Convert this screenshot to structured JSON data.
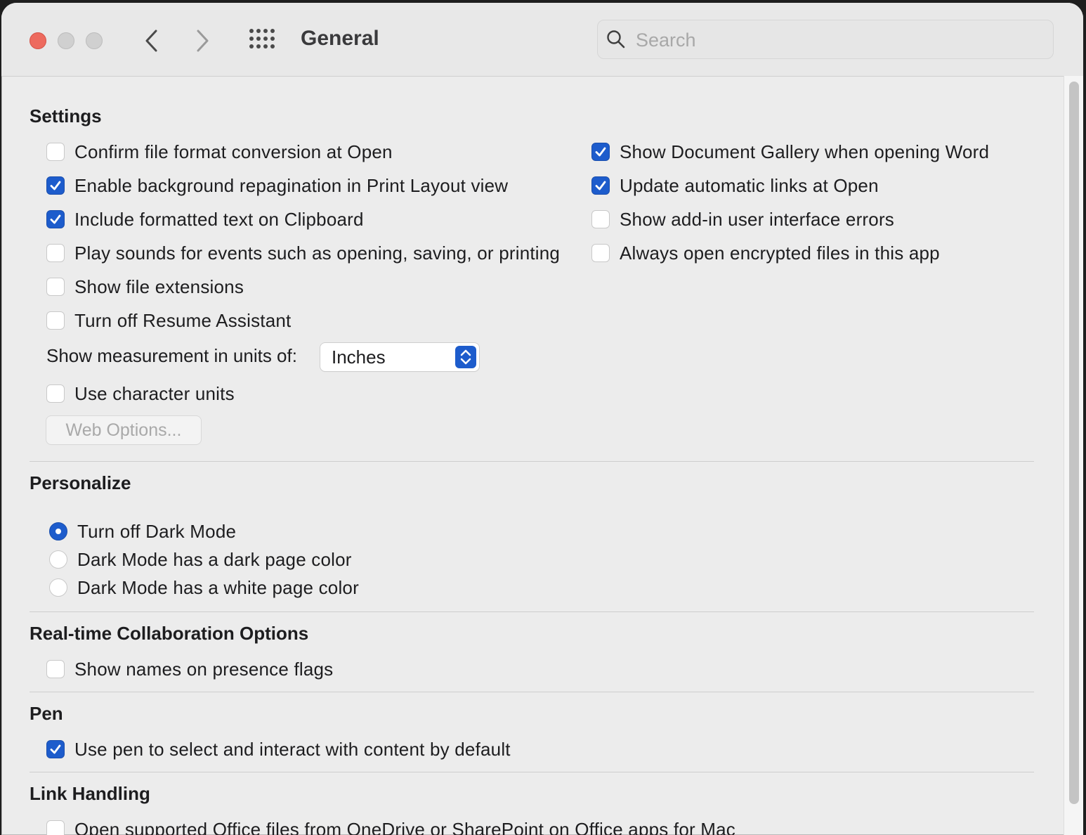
{
  "window": {
    "title": "General",
    "search_placeholder": "Search"
  },
  "settings": {
    "heading": "Settings",
    "left": [
      {
        "label": "Confirm file format conversion at Open",
        "checked": false
      },
      {
        "label": "Enable background repagination in Print Layout view",
        "checked": true
      },
      {
        "label": "Include formatted text on Clipboard",
        "checked": true
      },
      {
        "label": "Play sounds for events such as opening, saving, or printing",
        "checked": false
      },
      {
        "label": "Show file extensions",
        "checked": false
      },
      {
        "label": "Turn off Resume Assistant",
        "checked": false
      }
    ],
    "right": [
      {
        "label": "Show Document Gallery when opening Word",
        "checked": true
      },
      {
        "label": "Update automatic links at Open",
        "checked": true
      },
      {
        "label": "Show add-in user interface errors",
        "checked": false
      },
      {
        "label": "Always open encrypted files in this app",
        "checked": false
      }
    ],
    "units_label": "Show measurement in units of:",
    "units_value": "Inches",
    "character_units": {
      "label": "Use character units",
      "checked": false
    },
    "web_options_label": "Web Options..."
  },
  "personalize": {
    "heading": "Personalize",
    "options": [
      {
        "label": "Turn off Dark Mode",
        "selected": true
      },
      {
        "label": "Dark Mode has a dark page color",
        "selected": false
      },
      {
        "label": "Dark Mode has a white page color",
        "selected": false
      }
    ]
  },
  "collaboration": {
    "heading": "Real-time Collaboration Options",
    "options": [
      {
        "label": "Show names on presence flags",
        "checked": false
      }
    ]
  },
  "pen": {
    "heading": "Pen",
    "options": [
      {
        "label": "Use pen to select and interact with content by default",
        "checked": true
      }
    ]
  },
  "link_handling": {
    "heading": "Link Handling",
    "options": [
      {
        "label": "Open supported Office files from OneDrive or SharePoint on Office apps for Mac",
        "checked": false
      }
    ]
  },
  "colors": {
    "accent": "#1d5ccc",
    "close": "#ed6a5e",
    "background": "#ececec"
  },
  "icons": {
    "back": "chevron-left-icon",
    "forward": "chevron-right-icon",
    "grid": "grid-icon",
    "search": "search-icon"
  }
}
